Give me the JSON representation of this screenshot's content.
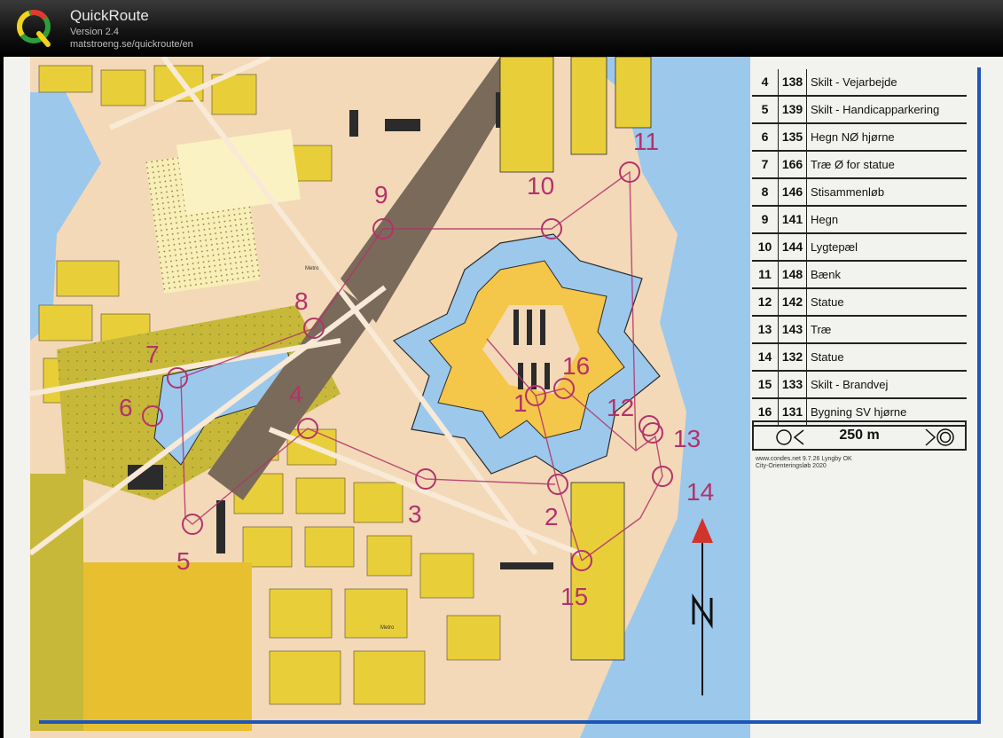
{
  "app": {
    "title": "QuickRoute",
    "version": "Version 2.4",
    "url": "matstroeng.se/quickroute/en"
  },
  "control_descriptions": [
    {
      "num": "4",
      "code": "138",
      "desc": "Skilt - Vejarbejde"
    },
    {
      "num": "5",
      "code": "139",
      "desc": "Skilt - Handicapparkering"
    },
    {
      "num": "6",
      "code": "135",
      "desc": "Hegn NØ hjørne"
    },
    {
      "num": "7",
      "code": "166",
      "desc": "Træ Ø for statue"
    },
    {
      "num": "8",
      "code": "146",
      "desc": "Stisammenløb"
    },
    {
      "num": "9",
      "code": "141",
      "desc": "Hegn"
    },
    {
      "num": "10",
      "code": "144",
      "desc": "Lygtepæl"
    },
    {
      "num": "11",
      "code": "148",
      "desc": "Bænk"
    },
    {
      "num": "12",
      "code": "142",
      "desc": "Statue"
    },
    {
      "num": "13",
      "code": "143",
      "desc": "Træ"
    },
    {
      "num": "14",
      "code": "132",
      "desc": "Statue"
    },
    {
      "num": "15",
      "code": "133",
      "desc": "Skilt - Brandvej"
    },
    {
      "num": "16",
      "code": "131",
      "desc": "Bygning SV hjørne"
    }
  ],
  "finish_distance": "250 m",
  "credit": {
    "line1": "www.condes.net 9.7.26 Lyngby OK",
    "line2": "City-Orienteringsløb 2020"
  },
  "map_labels": {
    "metro_1": "Metro",
    "metro_2": "Metro"
  },
  "controls": [
    {
      "label": "1"
    },
    {
      "label": "2"
    },
    {
      "label": "3"
    },
    {
      "label": "4"
    },
    {
      "label": "5"
    },
    {
      "label": "6"
    },
    {
      "label": "7"
    },
    {
      "label": "8"
    },
    {
      "label": "9"
    },
    {
      "label": "10"
    },
    {
      "label": "11"
    },
    {
      "label": "12"
    },
    {
      "label": "13"
    },
    {
      "label": "14"
    },
    {
      "label": "15"
    },
    {
      "label": "16"
    }
  ],
  "colors": {
    "course": "#b4326b",
    "water": "#9cc8ec",
    "open_land": "#f4c64a",
    "rough_open": "#e6d44a",
    "paved": "#f3d9b8",
    "building": "#2b2b2b",
    "north_arrow": "#d0342c"
  }
}
